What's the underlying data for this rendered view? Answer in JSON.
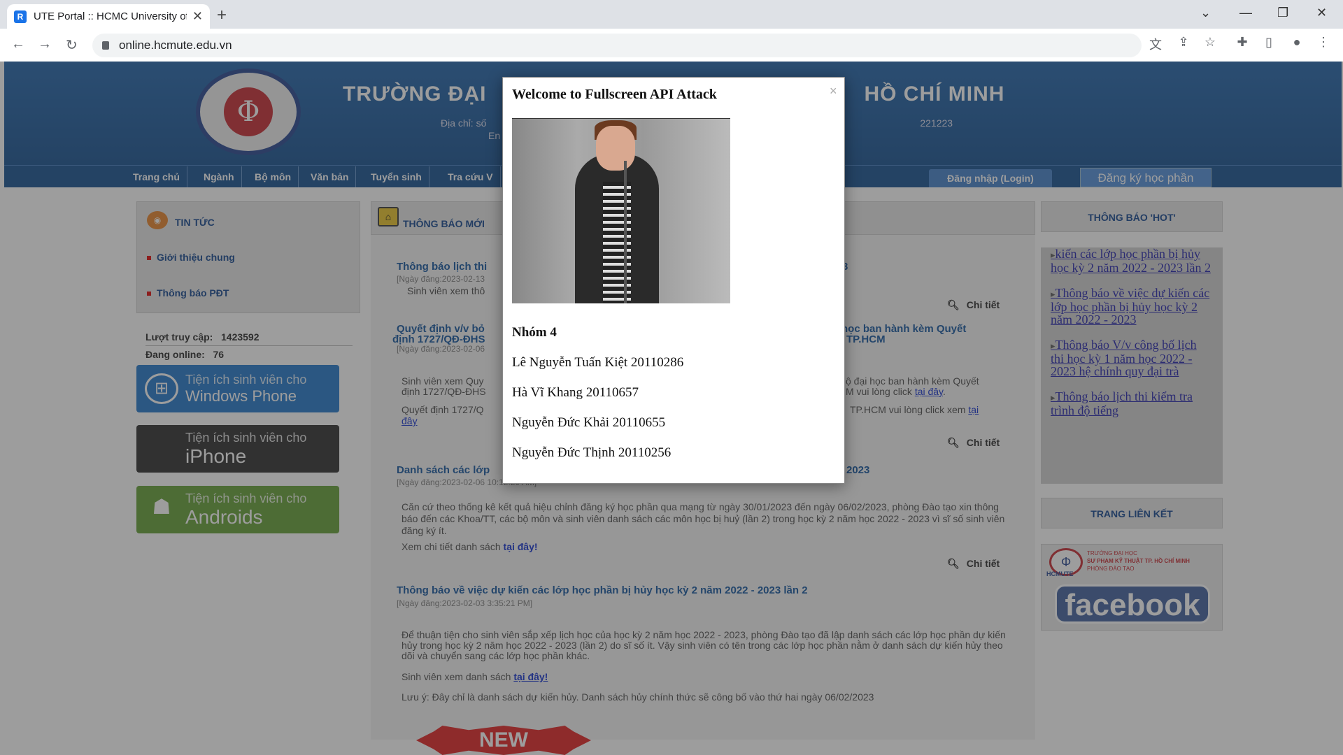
{
  "browser": {
    "tab_title": "UTE Portal :: HCMC University of",
    "url": "online.hcmute.edu.vn"
  },
  "site": {
    "title": "TRƯỜNG ĐẠI",
    "title_right": "HỒ CHÍ MINH",
    "address_left": "Địa chỉ: số",
    "address_right": "221223",
    "address_line2": "En",
    "nav": [
      "Trang chủ",
      "Ngành",
      "Bộ môn",
      "Văn bản",
      "Tuyển sinh",
      "Tra cứu V"
    ],
    "login": "Đăng nhập (Login)",
    "register": "Đăng ký học phần"
  },
  "left": {
    "news_heading": "TIN TỨC",
    "items": [
      "Giới thiệu chung",
      "Thông báo PĐT"
    ],
    "visits_label": "Lượt truy cập:",
    "visits_value": "1423592",
    "online_label": "Đang online:",
    "online_value": "76",
    "apps": [
      {
        "small": "Tiện ích sinh viên cho",
        "big": "Windows Phone",
        "color": "#1a73c8"
      },
      {
        "small": "Tiện ích sinh viên cho",
        "big": "iPhone",
        "color": "#262626"
      },
      {
        "small": "Tiện ích sinh viên cho",
        "big": "Androids",
        "color": "#5e9c2e"
      }
    ]
  },
  "center": {
    "heading": "THÔNG BÁO MỚI",
    "detail_label": "Chi tiết",
    "news": [
      {
        "title_a": "Thông báo lịch thi",
        "title_b": "3",
        "date": "[Ngày đăng:2023-02-13",
        "body": "Sinh viên xem thô"
      },
      {
        "title_a": "Quyết định v/v bỏ",
        "title_a2": "định 1727/QĐ-ĐHS",
        "title_b": "học ban hành kèm Quyết",
        "title_b2": "TP.HCM",
        "date": "[Ngày đăng:2023-02-06",
        "body1a": "Sinh viên xem Quy",
        "body1b": "ộ đại học ban hành kèm Quyết",
        "body2a": "định 1727/QĐ-ĐHS",
        "body2b": "M vui lòng click",
        "link1": "tại đây",
        "body3a": "Quyết định 1727/Q",
        "body3b": "TP.HCM vui lòng click xem",
        "link2a": "tại",
        "link2b": "đây"
      },
      {
        "title_a": "Danh sách các lớp",
        "title_b": "2023",
        "date": "[Ngày đăng:2023-02-06 10:12:29 AM]",
        "body": "Căn cứ theo thống kê kết quả hiệu chỉnh đăng ký học phần qua mạng từ ngày 30/01/2023 đến ngày 06/02/2023, phòng Đào tạo xin thông báo đến các Khoa/TT, các bộ môn và sinh viên danh sách các môn học bị huỷ (lần 2) trong học kỳ 2 năm học 2022 - 2023 vì sĩ số sinh viên đăng ký ít.",
        "more": "Xem chi tiết danh sách",
        "link": "tại đây!"
      },
      {
        "title": "Thông báo về việc dự kiến các lớp học phần bị hủy học kỳ 2 năm 2022 - 2023 lần 2",
        "date": "[Ngày đăng:2023-02-03 3:35:21 PM]",
        "body": "Để thuận tiện cho sinh viên sắp xếp lịch học của học kỳ 2 năm học 2022 - 2023, phòng Đào tạo đã lập danh sách các lớp học phần dự kiến hủy trong học kỳ 2 năm học 2022 - 2023 (lần 2) do sĩ số ít. Vậy sinh viên có tên trong các lớp học phần nằm ở danh sách dự kiến hủy theo dõi và chuyển sang các lớp học phần khác.",
        "more": "Sinh viên xem danh sách",
        "link": "tại đây!",
        "note": "Lưu ý: Đây chỉ là danh sách dự kiến hủy. Danh sách hủy chính thức sẽ công bố vào thứ hai ngày 06/02/2023"
      }
    ],
    "new_badge": "NEW"
  },
  "right": {
    "hot_heading": "THÔNG BÁO 'HOT'",
    "hot_items": [
      "kiến các lớp học phần bị hủy học kỳ 2 năm 2022 - 2023 lần 2",
      "Thông báo về việc dự kiến các lớp học phần bị hủy học kỳ 2 năm 2022 - 2023",
      "Thông báo V/v công bố lịch thi học kỳ 1 năm học 2022 - 2023 hệ chính quy đại trà",
      "Thông báo lịch thi kiểm tra trình độ tiếng"
    ],
    "links_heading": "TRANG LIÊN KẾT",
    "fb_small1": "TRƯỜNG ĐẠI HỌC",
    "fb_small2": "SƯ PHẠM KỸ THUẬT TP. HỒ CHÍ MINH",
    "fb_small3": "PHÒNG ĐÀO TẠO",
    "fb_hcmute": "HCMUTE",
    "fb_text": "facebook"
  },
  "modal": {
    "title": "Welcome to Fullscreen API Attack",
    "close": "×",
    "group": "Nhóm 4",
    "members": [
      "Lê Nguyễn Tuấn Kiệt 20110286",
      "Hà Vĩ Khang 20110657",
      "Nguyễn Đức Khải 20110655",
      "Nguyễn Đức Thịnh 20110256"
    ]
  }
}
